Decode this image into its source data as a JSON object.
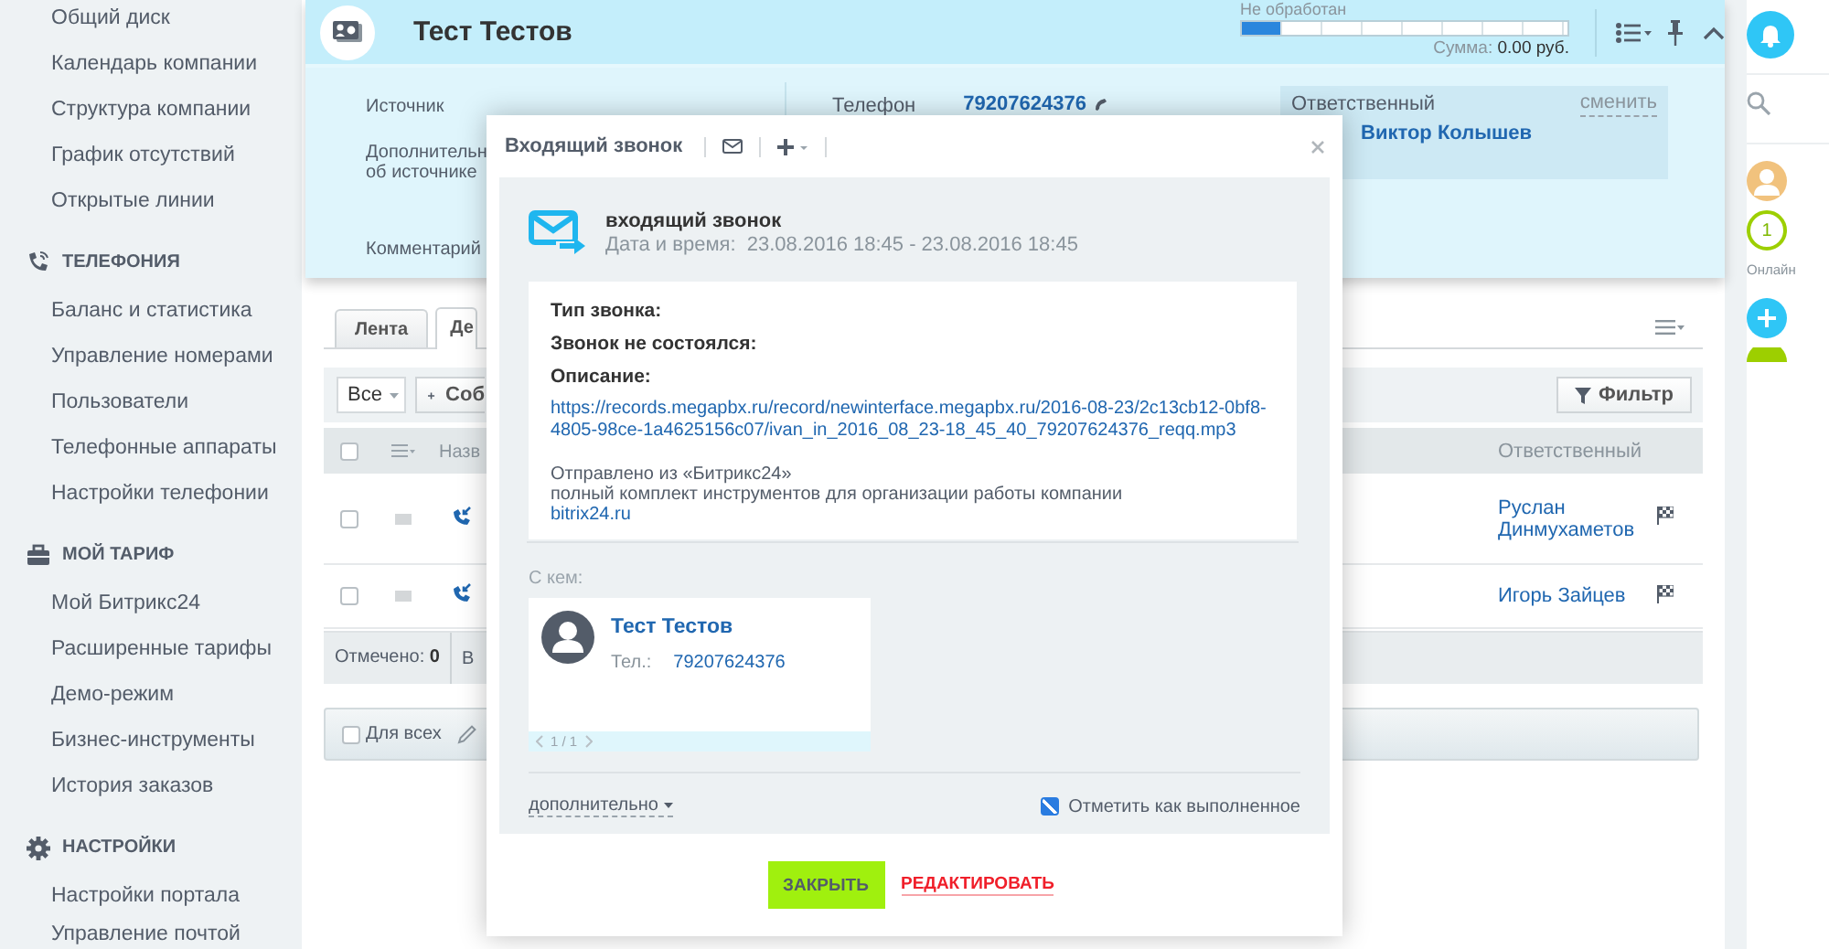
{
  "sidebar": {
    "items": [
      "Общий диск",
      "Календарь компании",
      "Структура компании",
      "График отсутствий",
      "Открытые линии"
    ],
    "sections": [
      {
        "title": "ТЕЛЕФОНИЯ",
        "items": [
          "Баланс и статистика",
          "Управление номерами",
          "Пользователи",
          "Телефонные аппараты",
          "Настройки телефонии"
        ]
      },
      {
        "title": "МОЙ ТАРИФ",
        "items": [
          "Мой Битрикс24",
          "Расширенные тарифы",
          "Демо-режим",
          "Бизнес-инструменты",
          "История заказов"
        ]
      },
      {
        "title": "НАСТРОЙКИ",
        "items": [
          "Настройки портала",
          "Управление почтой"
        ]
      }
    ]
  },
  "card": {
    "title": "Тест Тестов",
    "stage": {
      "label": "Не обработан",
      "level": 0.12
    },
    "sum_label": "Сумма:",
    "sum_value": "0.00 руб.",
    "labels": [
      "Источник",
      "Дополнительн\nоб источнике",
      "Комментарий"
    ],
    "phone": {
      "label": "Телефон",
      "value": "79207624376"
    },
    "responsible": {
      "label": "Ответственный",
      "action": "сменить",
      "name": "Виктор Колышев"
    }
  },
  "grid": {
    "tabs": [
      {
        "label": "Лента",
        "selected": false
      },
      {
        "label": "Де",
        "selected": true
      }
    ],
    "toolbar": {
      "select": "Все",
      "add_button": "Соб",
      "filter_button": "Фильтр"
    },
    "header": {
      "checked": false,
      "column_1": "Назв",
      "responsible": "Ответственный"
    },
    "rows": [
      {
        "checked": false,
        "responsible": "Руслан Динмухаметов"
      },
      {
        "checked": false,
        "responsible": "Игорь Зайцев"
      }
    ],
    "footer": {
      "selected_label": "Отмечено:",
      "selected_count": "0",
      "column_2": "В"
    },
    "actions": {
      "label": "Для всех",
      "checked": false
    }
  },
  "dialog": {
    "title": "Входящий звонок",
    "activity": {
      "title": "входящий звонок",
      "date_label": "Дата и время:",
      "date_value": "23.08.2016 18:45 - 23.08.2016 18:45"
    },
    "message": [
      {
        "kind": "heading",
        "text": "Тип звонка:"
      },
      {
        "kind": "heading",
        "text": "Звонок не состоялся:"
      },
      {
        "kind": "heading",
        "text": "Описание:"
      },
      {
        "kind": "link",
        "text": "https://records.megapbx.ru/record/newinterface.megapbx.ru/2016-08-23/2c13cb12-0bf8-4805-98ce-1a4625156c07/ivan_in_2016_08_23-18_45_40_79207624376_reqq.mp3"
      },
      {
        "kind": "note",
        "text": "Отправлено из «Битрикс24»"
      },
      {
        "kind": "note",
        "text": "полный комплект инструментов для организации работы компании"
      },
      {
        "kind": "link",
        "text": "bitrix24.ru"
      }
    ],
    "with_label": "С кем:",
    "contact": {
      "name": "Тест Тестов",
      "phone_label": "Тел.:",
      "phone": "79207624376",
      "pager": "1 / 1"
    },
    "more": "дополнительно",
    "complete": {
      "label": "Отметить как выполненное",
      "checked": true
    },
    "buttons": [
      {
        "label": "ЗАКРЫТЬ",
        "kind": "primary"
      },
      {
        "label": "РЕДАКТИРОВАТЬ",
        "kind": "link"
      }
    ]
  },
  "rightbar": {
    "online_count": "1",
    "online_label": "Онлайн"
  }
}
